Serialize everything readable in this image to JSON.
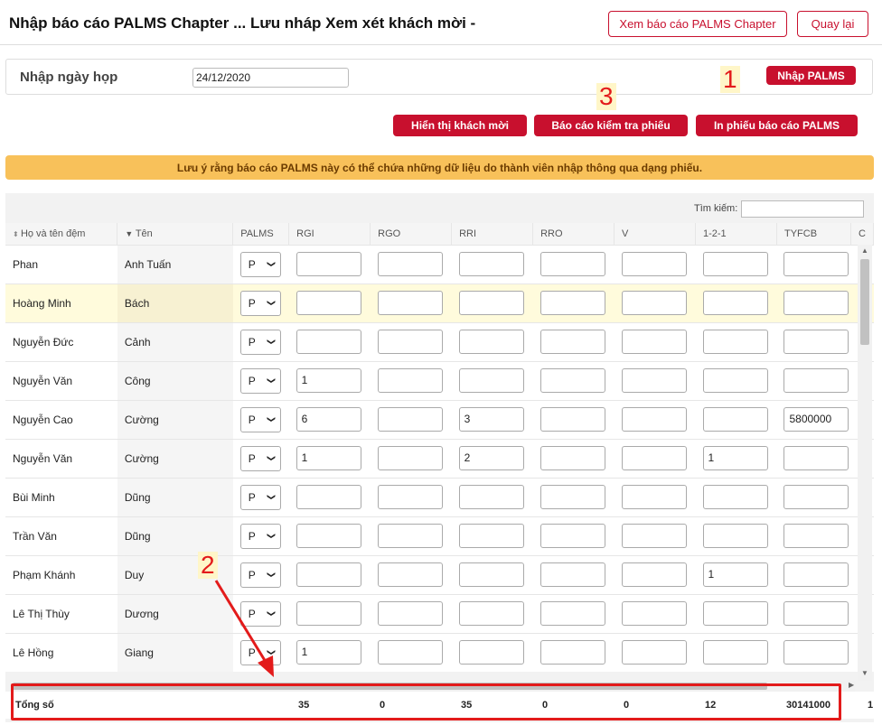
{
  "header": {
    "title": "Nhập báo cáo PALMS Chapter ... Lưu nháp   Xem xét khách mời -",
    "view_report_label": "Xem báo cáo PALMS Chapter",
    "back_label": "Quay lại"
  },
  "date_panel": {
    "label": "Nhập ngày họp",
    "date_value": "24/12/2020",
    "enter_palms_label": "Nhập PALMS"
  },
  "actions": {
    "show_guests_label": "Hiển thị khách mời",
    "check_report_label": "Báo cáo kiểm tra phiếu",
    "print_report_label": "In phiếu báo cáo PALMS"
  },
  "annotations": {
    "one": "1",
    "two": "2",
    "three": "3"
  },
  "notice": "Lưu ý rằng báo cáo PALMS này có thể chứa những dữ liệu do thành viên nhập thông qua dạng phiếu.",
  "search": {
    "label": "Tìm kiếm:"
  },
  "table": {
    "headers": [
      "Họ và tên đệm",
      "Tên",
      "PALMS",
      "RGI",
      "RGO",
      "RRI",
      "RRO",
      "V",
      "1-2-1",
      "TYFCB",
      "C"
    ],
    "rows": [
      {
        "ho": "Phan",
        "ten": "Anh Tuấn",
        "palms": "P",
        "rgi": "",
        "rgo": "",
        "rri": "",
        "rro": "",
        "v": "",
        "one21": "",
        "tyfcb": ""
      },
      {
        "ho": "Hoàng Minh",
        "ten": "Bách",
        "palms": "P",
        "rgi": "",
        "rgo": "",
        "rri": "",
        "rro": "",
        "v": "",
        "one21": "",
        "tyfcb": ""
      },
      {
        "ho": "Nguyễn Đức",
        "ten": "Cảnh",
        "palms": "P",
        "rgi": "",
        "rgo": "",
        "rri": "",
        "rro": "",
        "v": "",
        "one21": "",
        "tyfcb": ""
      },
      {
        "ho": "Nguyễn Văn",
        "ten": "Công",
        "palms": "P",
        "rgi": "1",
        "rgo": "",
        "rri": "",
        "rro": "",
        "v": "",
        "one21": "",
        "tyfcb": ""
      },
      {
        "ho": "Nguyễn Cao",
        "ten": "Cường",
        "palms": "P",
        "rgi": "6",
        "rgo": "",
        "rri": "3",
        "rro": "",
        "v": "",
        "one21": "",
        "tyfcb": "5800000"
      },
      {
        "ho": "Nguyễn Văn",
        "ten": "Cường",
        "palms": "P",
        "rgi": "1",
        "rgo": "",
        "rri": "2",
        "rro": "",
        "v": "",
        "one21": "1",
        "tyfcb": ""
      },
      {
        "ho": "Bùi Minh",
        "ten": "Dũng",
        "palms": "P",
        "rgi": "",
        "rgo": "",
        "rri": "",
        "rro": "",
        "v": "",
        "one21": "",
        "tyfcb": ""
      },
      {
        "ho": "Trần Văn",
        "ten": "Dũng",
        "palms": "P",
        "rgi": "",
        "rgo": "",
        "rri": "",
        "rro": "",
        "v": "",
        "one21": "",
        "tyfcb": ""
      },
      {
        "ho": "Phạm Khánh",
        "ten": "Duy",
        "palms": "P",
        "rgi": "",
        "rgo": "",
        "rri": "",
        "rro": "",
        "v": "",
        "one21": "1",
        "tyfcb": ""
      },
      {
        "ho": "Lê Thị Thùy",
        "ten": "Dương",
        "palms": "P",
        "rgi": "",
        "rgo": "",
        "rri": "",
        "rro": "",
        "v": "",
        "one21": "",
        "tyfcb": ""
      },
      {
        "ho": "Lê Hồng",
        "ten": "Giang",
        "palms": "P",
        "rgi": "1",
        "rgo": "",
        "rri": "",
        "rro": "",
        "v": "",
        "one21": "",
        "tyfcb": ""
      }
    ],
    "totals": {
      "label": "Tổng số",
      "rgi": "35",
      "rgo": "0",
      "rri": "35",
      "rro": "0",
      "v": "0",
      "one21": "12",
      "tyfcb": "30141000",
      "c": "1"
    }
  },
  "colors": {
    "brand_red": "#c8102e",
    "notice_bg": "#f8c15a",
    "annotation_red": "#e31b1b"
  }
}
